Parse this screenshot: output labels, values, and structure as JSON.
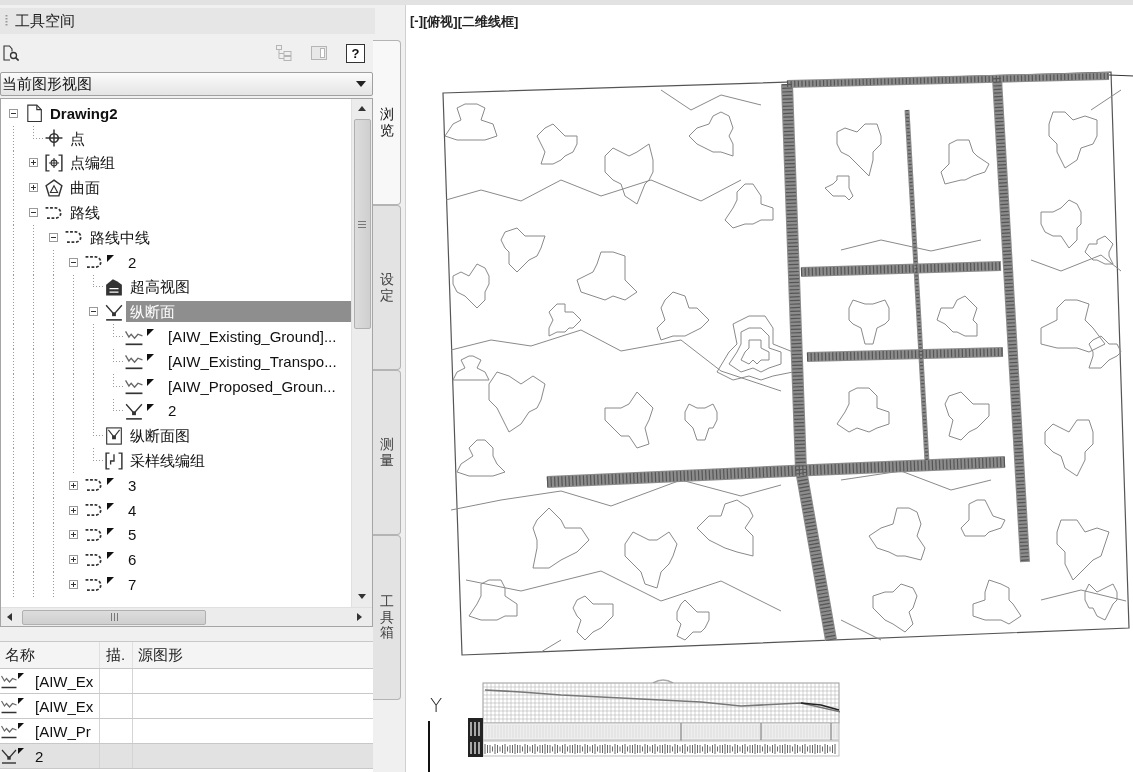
{
  "palette": {
    "title": "工具空间"
  },
  "toolbar": [
    {
      "kind": "document-search",
      "disabled": false
    },
    {
      "kind": "hierarchy",
      "disabled": true
    },
    {
      "kind": "panel",
      "disabled": true
    },
    {
      "kind": "help",
      "label": "?",
      "disabled": false
    }
  ],
  "view_selector": {
    "value": "当前图形视图"
  },
  "tree": {
    "items": [
      {
        "label": "Drawing2",
        "kind": "drawing",
        "expanded": true,
        "selected": false,
        "children": [
          {
            "label": "点",
            "kind": "point",
            "selected": false
          },
          {
            "label": "点编组",
            "kind": "point-group",
            "expanded": false,
            "selected": false
          },
          {
            "label": "曲面",
            "kind": "surface",
            "expanded": false,
            "selected": false
          },
          {
            "label": "路线",
            "kind": "alignments",
            "expanded": true,
            "selected": false,
            "children": [
              {
                "label": "路线中线",
                "kind": "alignment-site",
                "expanded": true,
                "selected": false,
                "children": [
                  {
                    "label": "2",
                    "kind": "alignment",
                    "expanded": true,
                    "selected": false,
                    "children": [
                      {
                        "label": "超高视图",
                        "kind": "superelevation-view",
                        "selected": false
                      },
                      {
                        "label": "纵断面",
                        "kind": "profiles",
                        "expanded": true,
                        "selected": true,
                        "children": [
                          {
                            "label": "[AIW_Existing_Ground]...",
                            "kind": "profile",
                            "selected": false
                          },
                          {
                            "label": "[AIW_Existing_Transpo...",
                            "kind": "profile",
                            "selected": false
                          },
                          {
                            "label": "[AIW_Proposed_Groun...",
                            "kind": "profile",
                            "selected": false
                          },
                          {
                            "label": "2",
                            "kind": "layout-profile",
                            "selected": false
                          }
                        ]
                      },
                      {
                        "label": "纵断面图",
                        "kind": "profile-view",
                        "selected": false
                      },
                      {
                        "label": "采样线编组",
                        "kind": "sample-line-group",
                        "selected": false
                      }
                    ]
                  },
                  {
                    "label": "3",
                    "kind": "alignment",
                    "expanded": false,
                    "selected": false
                  },
                  {
                    "label": "4",
                    "kind": "alignment",
                    "expanded": false,
                    "selected": false
                  },
                  {
                    "label": "5",
                    "kind": "alignment",
                    "expanded": false,
                    "selected": false
                  },
                  {
                    "label": "6",
                    "kind": "alignment",
                    "expanded": false,
                    "selected": false
                  },
                  {
                    "label": "7",
                    "kind": "alignment",
                    "expanded": false,
                    "selected": false
                  }
                ]
              }
            ]
          }
        ]
      }
    ]
  },
  "tabs": [
    {
      "label": "浏览",
      "selected": true
    },
    {
      "label": "设定",
      "selected": false
    },
    {
      "label": "测量",
      "selected": false
    },
    {
      "label": "工具箱",
      "selected": false
    }
  ],
  "list": {
    "columns": [
      "名称",
      "描.",
      "源图形"
    ],
    "rows": [
      {
        "kind": "profile",
        "name": "[AIW_Ex",
        "selected": false
      },
      {
        "kind": "profile",
        "name": "[AIW_Ex",
        "selected": false
      },
      {
        "kind": "profile",
        "name": "[AIW_Pr",
        "selected": false
      },
      {
        "kind": "layout-profile",
        "name": "2",
        "selected": true
      }
    ]
  },
  "viewport": {
    "controls": [
      "[-]",
      "[俯视]",
      "[二维线框]"
    ],
    "ucs_label": "Y"
  }
}
